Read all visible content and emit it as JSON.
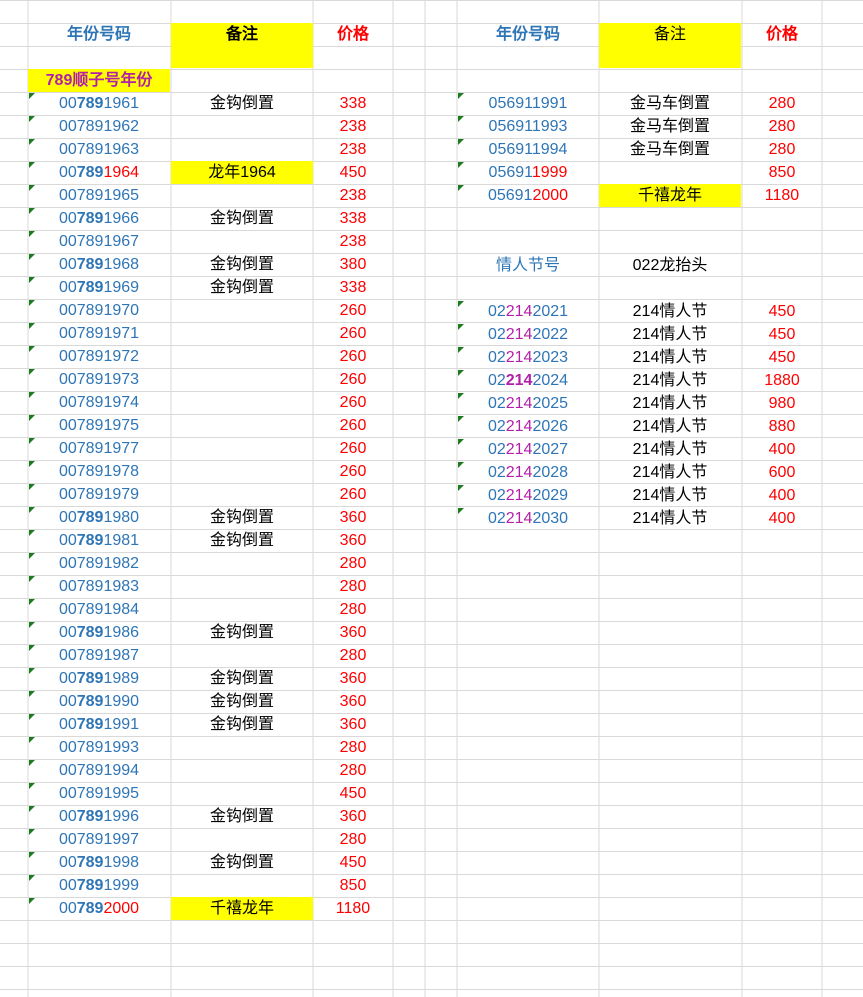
{
  "headers": {
    "code": "年份号码",
    "note": "备注",
    "price": "价格"
  },
  "section_left_title": "789顺子号年份",
  "left_rows": [
    {
      "code": [
        "00",
        "789",
        "1961"
      ],
      "note": "金钩倒置",
      "price": "338",
      "style": "bold789"
    },
    {
      "code": [
        "007891962"
      ],
      "note": "",
      "price": "238",
      "style": "plain"
    },
    {
      "code": [
        "007891963"
      ],
      "note": "",
      "price": "238",
      "style": "plain"
    },
    {
      "code": [
        "00",
        "789",
        "1964"
      ],
      "note": "龙年1964",
      "price": "450",
      "style": "bold789red",
      "note_bg": "yellow"
    },
    {
      "code": [
        "007891965"
      ],
      "note": "",
      "price": "238",
      "style": "plain"
    },
    {
      "code": [
        "00",
        "789",
        "1966"
      ],
      "note": "金钩倒置",
      "price": "338",
      "style": "bold789"
    },
    {
      "code": [
        "007891967"
      ],
      "note": "",
      "price": "238",
      "style": "plain"
    },
    {
      "code": [
        "00",
        "789",
        "1968"
      ],
      "note": "金钩倒置",
      "price": "380",
      "style": "bold789"
    },
    {
      "code": [
        "00",
        "789",
        "1969"
      ],
      "note": "金钩倒置",
      "price": "338",
      "style": "bold789"
    },
    {
      "code": [
        "007891970"
      ],
      "note": "",
      "price": "260",
      "style": "plain"
    },
    {
      "code": [
        "007891971"
      ],
      "note": "",
      "price": "260",
      "style": "plain"
    },
    {
      "code": [
        "007891972"
      ],
      "note": "",
      "price": "260",
      "style": "plain"
    },
    {
      "code": [
        "007891973"
      ],
      "note": "",
      "price": "260",
      "style": "plain"
    },
    {
      "code": [
        "007891974"
      ],
      "note": "",
      "price": "260",
      "style": "plain"
    },
    {
      "code": [
        "007891975"
      ],
      "note": "",
      "price": "260",
      "style": "plain"
    },
    {
      "code": [
        "007891977"
      ],
      "note": "",
      "price": "260",
      "style": "plain"
    },
    {
      "code": [
        "007891978"
      ],
      "note": "",
      "price": "260",
      "style": "plain"
    },
    {
      "code": [
        "007891979"
      ],
      "note": "",
      "price": "260",
      "style": "plain"
    },
    {
      "code": [
        "00",
        "789",
        "1980"
      ],
      "note": "金钩倒置",
      "price": "360",
      "style": "bold789"
    },
    {
      "code": [
        "00",
        "789",
        "1981"
      ],
      "note": "金钩倒置",
      "price": "360",
      "style": "bold789"
    },
    {
      "code": [
        "007891982"
      ],
      "note": "",
      "price": "280",
      "style": "plain"
    },
    {
      "code": [
        "007891983"
      ],
      "note": "",
      "price": "280",
      "style": "plain"
    },
    {
      "code": [
        "007891984"
      ],
      "note": "",
      "price": "280",
      "style": "plain"
    },
    {
      "code": [
        "00",
        "789",
        "1986"
      ],
      "note": "金钩倒置",
      "price": "360",
      "style": "bold789"
    },
    {
      "code": [
        "007891987"
      ],
      "note": "",
      "price": "280",
      "style": "plain"
    },
    {
      "code": [
        "00",
        "789",
        "1989"
      ],
      "note": "金钩倒置",
      "price": "360",
      "style": "bold789"
    },
    {
      "code": [
        "00",
        "789",
        "1990"
      ],
      "note": "金钩倒置",
      "price": "360",
      "style": "bold789"
    },
    {
      "code": [
        "00",
        "789",
        "1991"
      ],
      "note": "金钩倒置",
      "price": "360",
      "style": "bold789"
    },
    {
      "code": [
        "007891993"
      ],
      "note": "",
      "price": "280",
      "style": "plain"
    },
    {
      "code": [
        "007891994"
      ],
      "note": "",
      "price": "280",
      "style": "plain"
    },
    {
      "code": [
        "007891995"
      ],
      "note": "",
      "price": "450",
      "style": "plain"
    },
    {
      "code": [
        "00",
        "789",
        "1996"
      ],
      "note": "金钩倒置",
      "price": "360",
      "style": "bold789"
    },
    {
      "code": [
        "007891997"
      ],
      "note": "",
      "price": "280",
      "style": "plain"
    },
    {
      "code": [
        "00",
        "789",
        "1998"
      ],
      "note": "金钩倒置",
      "price": "450",
      "style": "bold789"
    },
    {
      "code": [
        "00",
        "789",
        "1999"
      ],
      "note": "",
      "price": "850",
      "style": "bold789"
    },
    {
      "code": [
        "00",
        "789",
        "2000"
      ],
      "note": "千禧龙年",
      "price": "1180",
      "style": "bold789red",
      "note_bg": "yellow"
    }
  ],
  "right_rows_a": [
    {
      "code": [
        "056911991"
      ],
      "note": "金马车倒置",
      "price": "280",
      "style": "plain"
    },
    {
      "code": [
        "056911993"
      ],
      "note": "金马车倒置",
      "price": "280",
      "style": "plain"
    },
    {
      "code": [
        "056911994"
      ],
      "note": "金马车倒置",
      "price": "280",
      "style": "plain"
    },
    {
      "code": [
        "05691",
        "1999"
      ],
      "note": "",
      "price": "850",
      "style": "redtail"
    },
    {
      "code": [
        "05691",
        "2000"
      ],
      "note": "千禧龙年",
      "price": "1180",
      "style": "redtail",
      "note_bg": "yellow"
    }
  ],
  "right_section_title": "情人节号",
  "right_section_note": "022龙抬头",
  "right_rows_b": [
    {
      "code": [
        "02",
        "214",
        "2021"
      ],
      "note": "214情人节",
      "price": "450",
      "style": "purple"
    },
    {
      "code": [
        "02",
        "214",
        "2022"
      ],
      "note": "214情人节",
      "price": "450",
      "style": "purple"
    },
    {
      "code": [
        "02",
        "214",
        "2023"
      ],
      "note": "214情人节",
      "price": "450",
      "style": "purple"
    },
    {
      "code": [
        "02",
        "214",
        "2024"
      ],
      "note": "214情人节",
      "price": "1880",
      "style": "purplebold"
    },
    {
      "code": [
        "02",
        "214",
        "2025"
      ],
      "note": "214情人节",
      "price": "980",
      "style": "purple"
    },
    {
      "code": [
        "02",
        "214",
        "2026"
      ],
      "note": "214情人节",
      "price": "880",
      "style": "purple"
    },
    {
      "code": [
        "02",
        "214",
        "2027"
      ],
      "note": "214情人节",
      "price": "400",
      "style": "purple"
    },
    {
      "code": [
        "02",
        "214",
        "2028"
      ],
      "note": "214情人节",
      "price": "600",
      "style": "purple"
    },
    {
      "code": [
        "02",
        "214",
        "2029"
      ],
      "note": "214情人节",
      "price": "400",
      "style": "purple"
    },
    {
      "code": [
        "02",
        "214",
        "2030"
      ],
      "note": "214情人节",
      "price": "400",
      "style": "purple"
    }
  ],
  "colors": {
    "blue": "#2e75b6",
    "red": "#ff0000",
    "purple": "#b21fa8",
    "yellow": "#ffff00",
    "grid": "#d9d9d9",
    "marker": "#1e7a1e"
  }
}
